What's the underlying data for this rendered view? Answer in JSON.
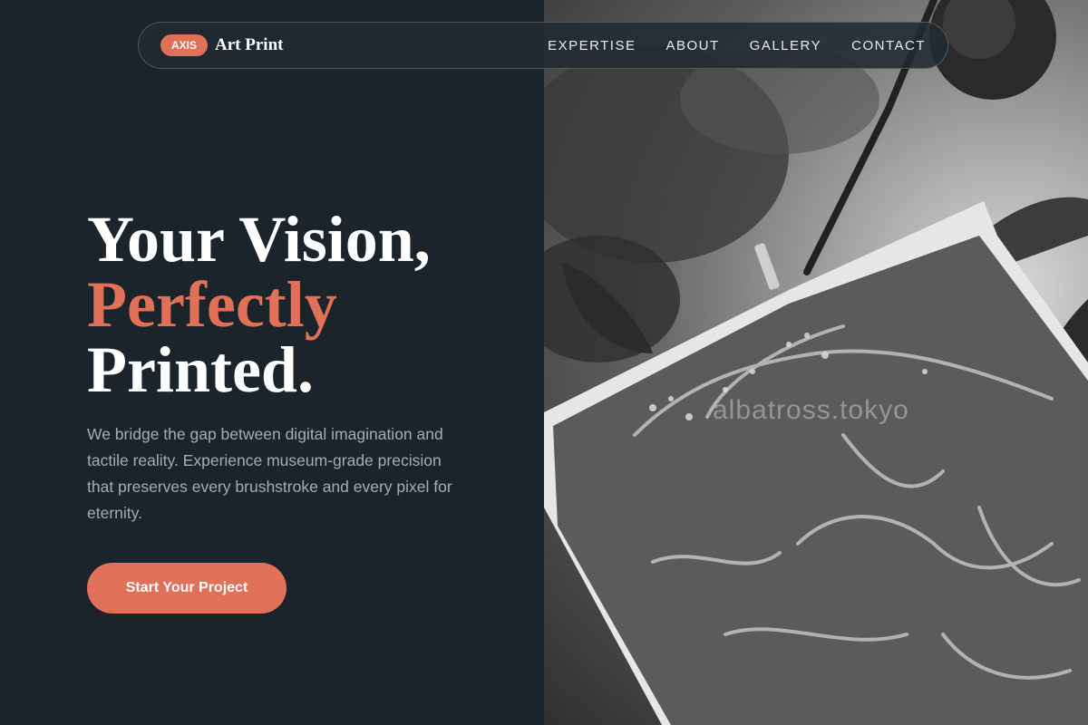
{
  "nav": {
    "badge": "AXIS",
    "brand": "Art Print",
    "links": [
      "EXPERTISE",
      "ABOUT",
      "GALLERY",
      "CONTACT"
    ]
  },
  "hero": {
    "line1": "Your Vision,",
    "line2": "Perfectly",
    "line3": "Printed.",
    "description": "We bridge the gap between digital imagination and tactile reality. Experience museum-grade precision that preserves every brushstroke and every pixel for eternity.",
    "cta": "Start Your Project"
  },
  "image": {
    "watermark": "albatross.tokyo",
    "subject": "grayscale photo of a printed cyanotype sheet hanging from a branch among leaves"
  },
  "colors": {
    "background": "#1c242b",
    "accent": "#e07058",
    "text": "#ffffff",
    "muted_text": "#a4adb4"
  }
}
